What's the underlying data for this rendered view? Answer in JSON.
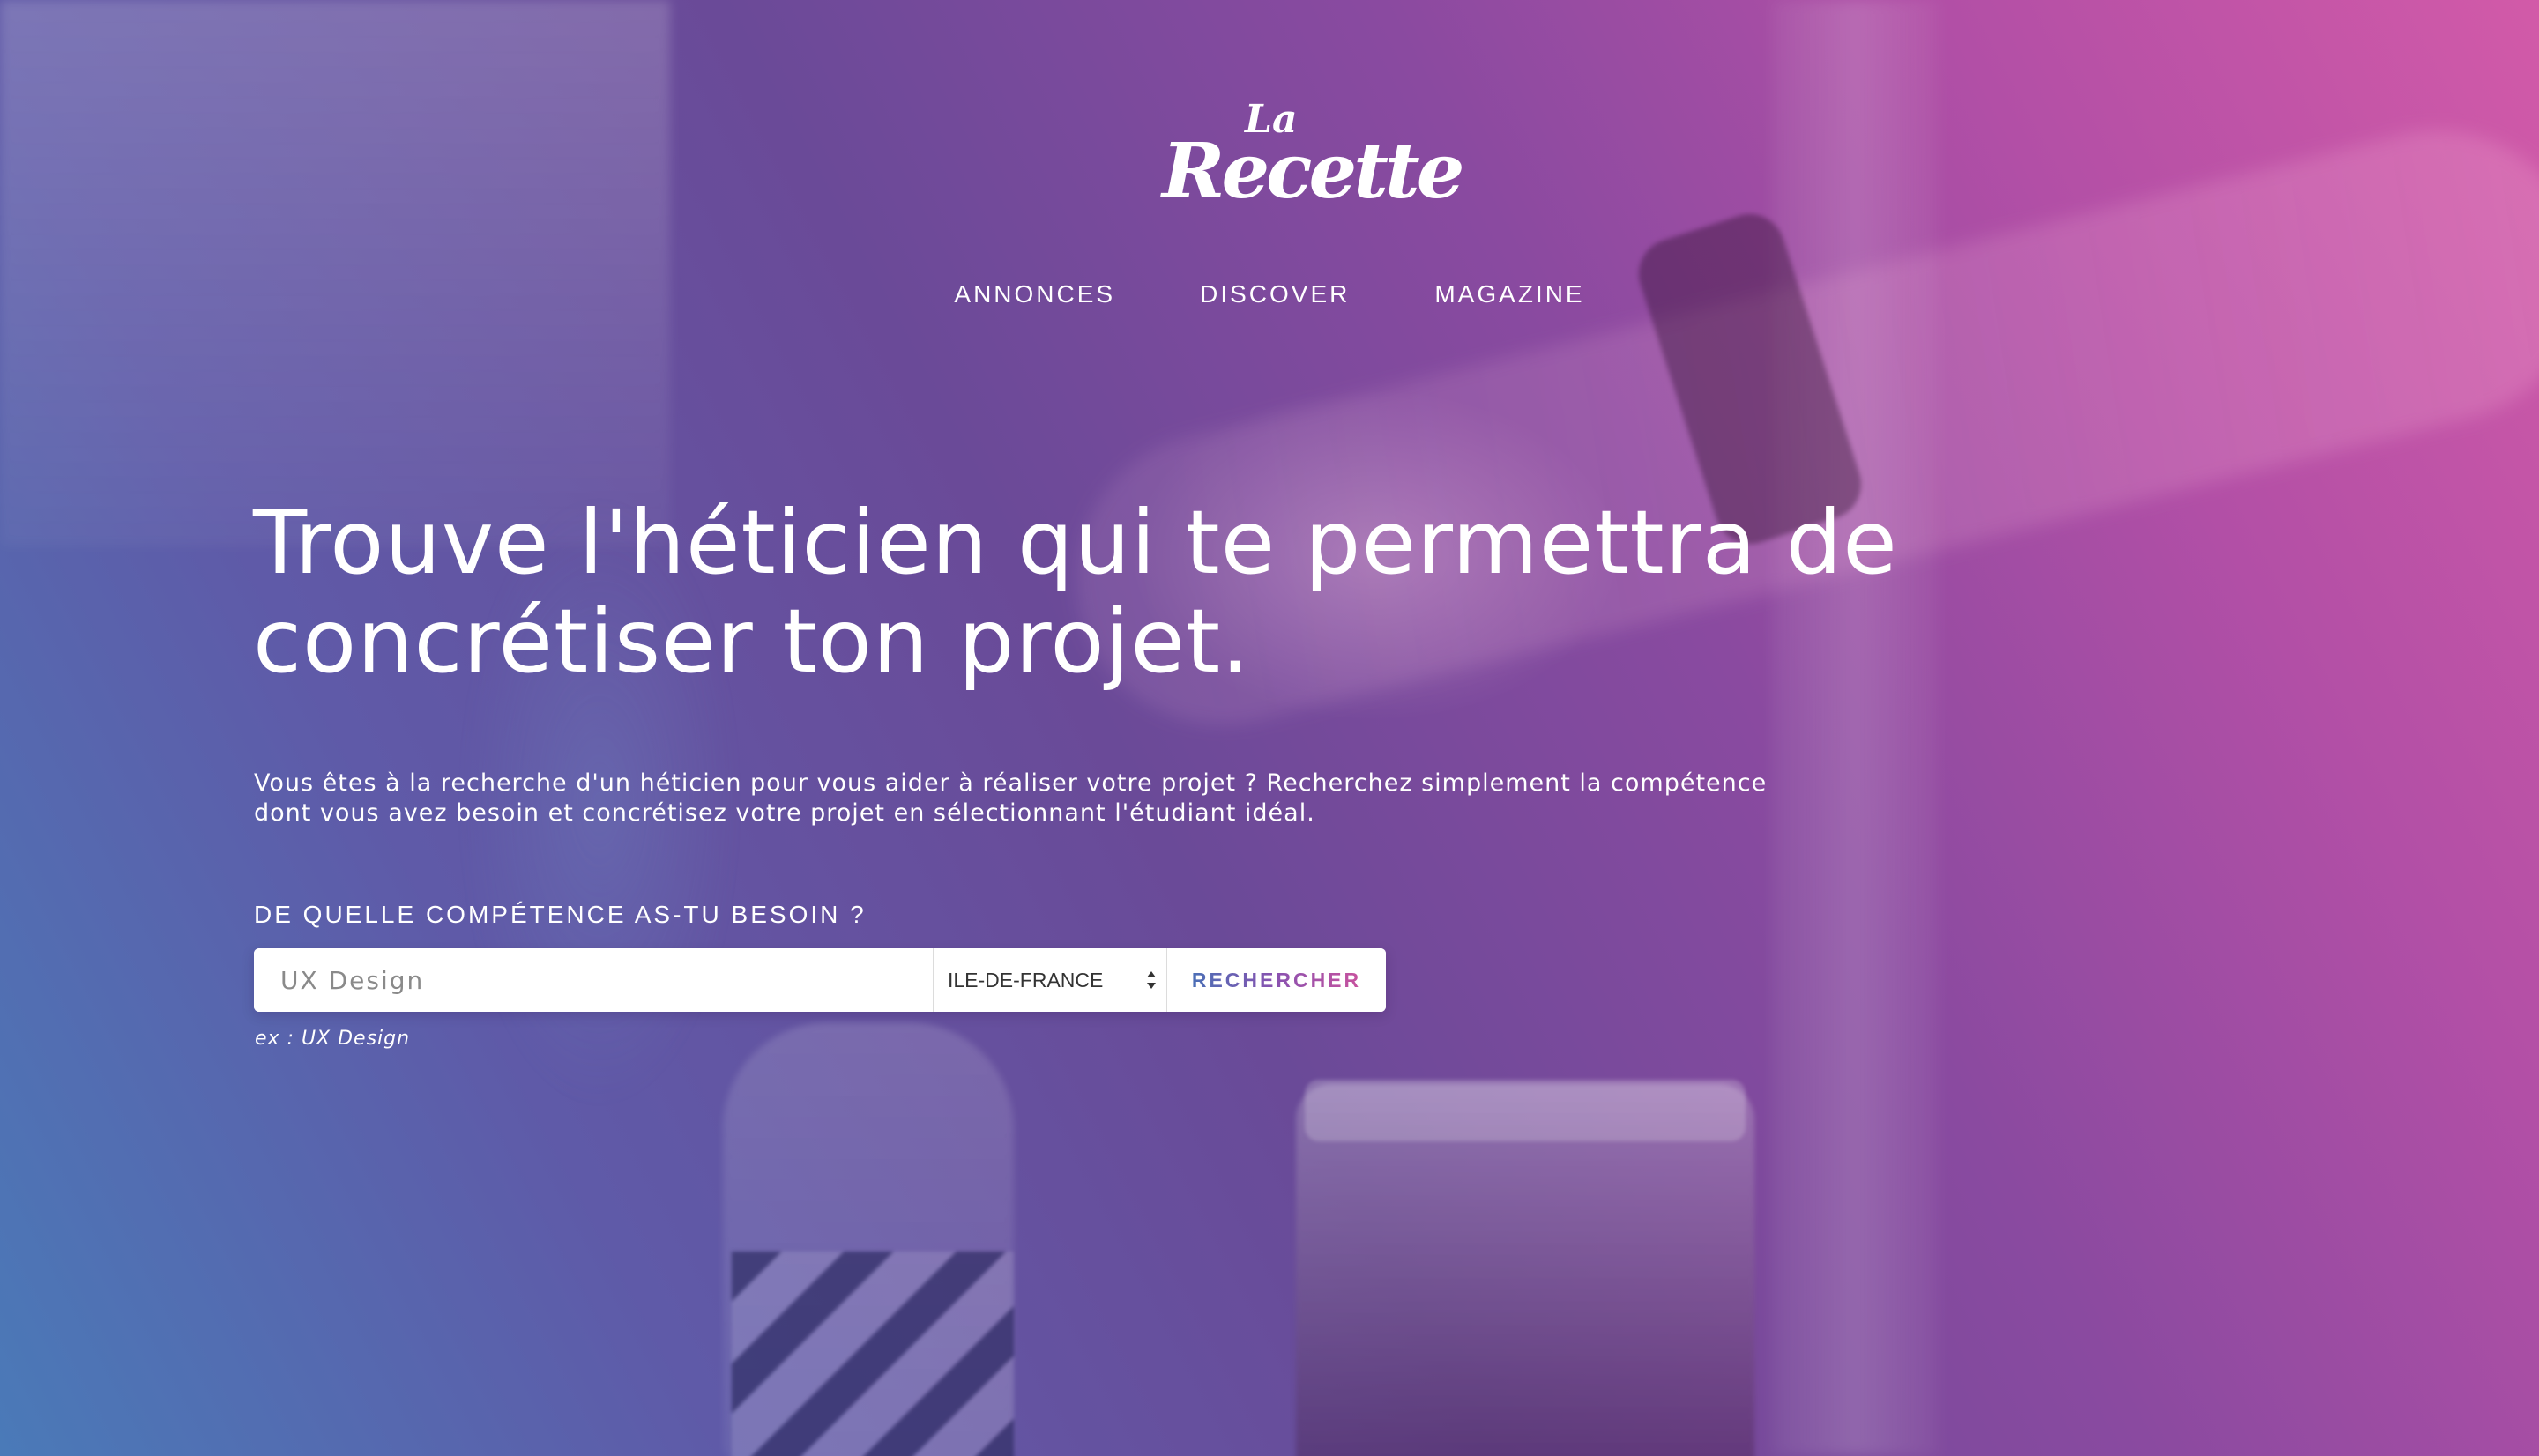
{
  "brand": {
    "logo_small": "La",
    "logo_main": "Recette"
  },
  "nav": {
    "items": [
      {
        "label": "ANNONCES"
      },
      {
        "label": "DISCOVER"
      },
      {
        "label": "MAGAZINE"
      }
    ]
  },
  "hero": {
    "headline_line1": "Trouve l'héticien qui te permettra de",
    "headline_line2": "concrétiser ton projet.",
    "lead_line1": "Vous êtes à la recherche d'un héticien pour vous aider à réaliser votre projet ? Recherchez simplement la compétence",
    "lead_line2": "dont vous avez besoin et concrétisez votre projet en sélectionnant l'étudiant idéal."
  },
  "search": {
    "label": "DE QUELLE COMPÉTENCE AS-TU BESOIN ?",
    "input_placeholder": "UX Design",
    "input_value": "",
    "region_selected": "ILE-DE-FRANCE",
    "button_label": "RECHERCHER",
    "hint": "ex : UX Design"
  },
  "colors": {
    "gradient_left": "#4a7ab8",
    "gradient_mid": "#6a4a98",
    "gradient_right": "#d25aa8",
    "button_gradient_start": "#4b6fb6",
    "button_gradient_end": "#c8529e"
  },
  "icons": {
    "select_arrows": "updown-arrows-icon"
  }
}
